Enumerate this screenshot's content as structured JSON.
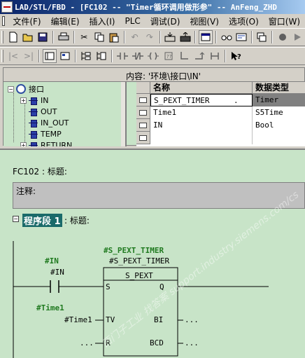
{
  "titlebar": {
    "title": "LAD/STL/FBD - [FC102 -- \"Timer循环调用做形参\" -- AnFeng_ZHD"
  },
  "menu": {
    "items": [
      "文件(F)",
      "编辑(E)",
      "插入(I)",
      "PLC",
      "调试(D)",
      "视图(V)",
      "选项(O)",
      "窗口(W)"
    ]
  },
  "interface": {
    "content_label": "内容: '环境\\接口\\IN'",
    "tree": {
      "root": "接口",
      "items": [
        "IN",
        "OUT",
        "IN_OUT",
        "TEMP",
        "RETURN"
      ]
    },
    "table": {
      "columns": [
        "名称",
        "数据类型"
      ],
      "rows": [
        {
          "name": "S_PEXT_TIMER",
          "extra": ".",
          "type": "Timer"
        },
        {
          "name": "Time1",
          "type": "S5Time"
        },
        {
          "name": "IN",
          "type": "Bool"
        },
        {
          "name": "",
          "type": ""
        }
      ]
    }
  },
  "code": {
    "fc_title": "FC102 : 标题:",
    "comment_label": "注释:",
    "network": {
      "label": "程序段 1",
      "title": ": 标题:"
    },
    "ladder": {
      "contact_symbol": "#IN",
      "contact_address": "#IN",
      "box_symbol": "#S_PEXT_TIMER",
      "box_address": "#S_PEXT_TIMER",
      "box_type": "S_PEXT",
      "tv_symbol": "#Time1",
      "tv_address": "#Time1",
      "r_param": "...",
      "bi_param": "...",
      "bcd_param": "...",
      "pins_left": [
        "S",
        "TV",
        "R"
      ],
      "pins_right": [
        "Q",
        "BI",
        "BCD"
      ]
    }
  },
  "watermark": {
    "text": "西门子工业 找答案 support.industry.siemens.com/cs"
  },
  "colors": {
    "editor_background": "#c8e4c8",
    "title_gradient_start": "#0a246a",
    "network_label_bg": "#1a6a6a",
    "symbol_green": "#207a20"
  }
}
